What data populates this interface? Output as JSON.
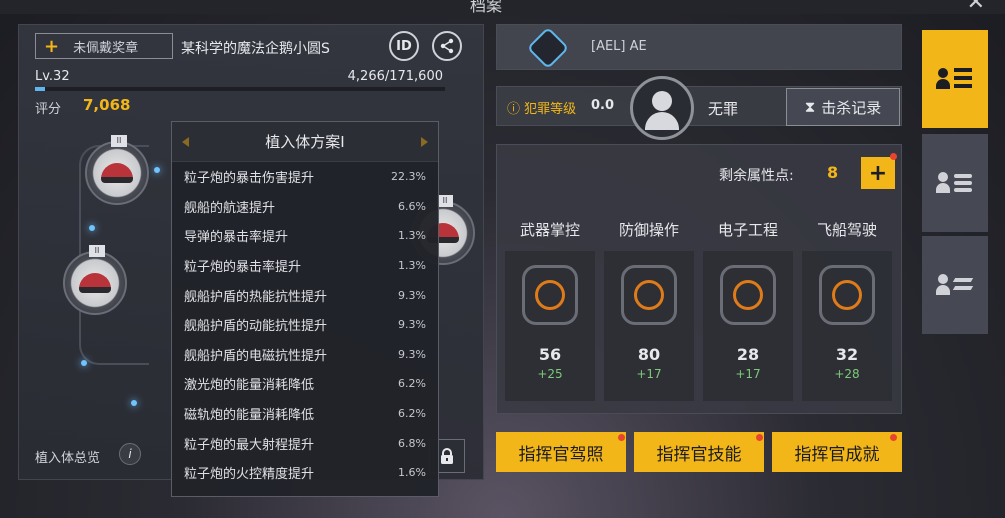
{
  "window": {
    "title": "档案",
    "close_label": "✕"
  },
  "left": {
    "badge_button": "未佩戴奖章",
    "badge_plus": "+",
    "player_name": "某科学的魔法企鹅小圆S",
    "id_button": "ID",
    "level": "Lv.32",
    "xp_text": "4,266/171,600",
    "xp_progress": 0.025,
    "score_label": "评分",
    "score_value": "7,068",
    "implant_tier": "II",
    "overview_label": "植入体总览",
    "info_label": "i"
  },
  "dropdown": {
    "title": "植入体方案Ⅰ",
    "items": [
      {
        "label": "粒子炮的暴击伤害提升",
        "value": "22.3%"
      },
      {
        "label": "舰船的航速提升",
        "value": "6.6%"
      },
      {
        "label": "导弹的暴击率提升",
        "value": "1.3%"
      },
      {
        "label": "粒子炮的暴击率提升",
        "value": "1.3%"
      },
      {
        "label": "舰船护盾的热能抗性提升",
        "value": "9.3%"
      },
      {
        "label": "舰船护盾的动能抗性提升",
        "value": "9.3%"
      },
      {
        "label": "舰船护盾的电磁抗性提升",
        "value": "9.3%"
      },
      {
        "label": "激光炮的能量消耗降低",
        "value": "6.2%"
      },
      {
        "label": "磁轨炮的能量消耗降低",
        "value": "6.2%"
      },
      {
        "label": "粒子炮的最大射程提升",
        "value": "6.8%"
      },
      {
        "label": "粒子炮的火控精度提升",
        "value": "1.6%"
      }
    ]
  },
  "right": {
    "guild_name": "[AEL] AE",
    "crime_label": "犯罪等级",
    "crime_value": "0.0",
    "status": "无罪",
    "kill_record": "击杀记录",
    "remaining_label": "剩余属性点:",
    "remaining_value": "8",
    "add_label": "+",
    "skills": [
      {
        "name": "武器掌控",
        "value": "56",
        "bonus": "+25",
        "icon": "weapon-icon"
      },
      {
        "name": "防御操作",
        "value": "80",
        "bonus": "+17",
        "icon": "shield-icon"
      },
      {
        "name": "电子工程",
        "value": "28",
        "bonus": "+17",
        "icon": "chip-icon"
      },
      {
        "name": "飞船驾驶",
        "value": "32",
        "bonus": "+28",
        "icon": "pilot-icon"
      }
    ],
    "buttons": [
      "指挥官驾照",
      "指挥官技能",
      "指挥官成就"
    ]
  },
  "colors": {
    "accent": "#f2b619",
    "bonus": "#7dc97a",
    "alert": "#e8452f",
    "xp": "#5fb6ec"
  }
}
